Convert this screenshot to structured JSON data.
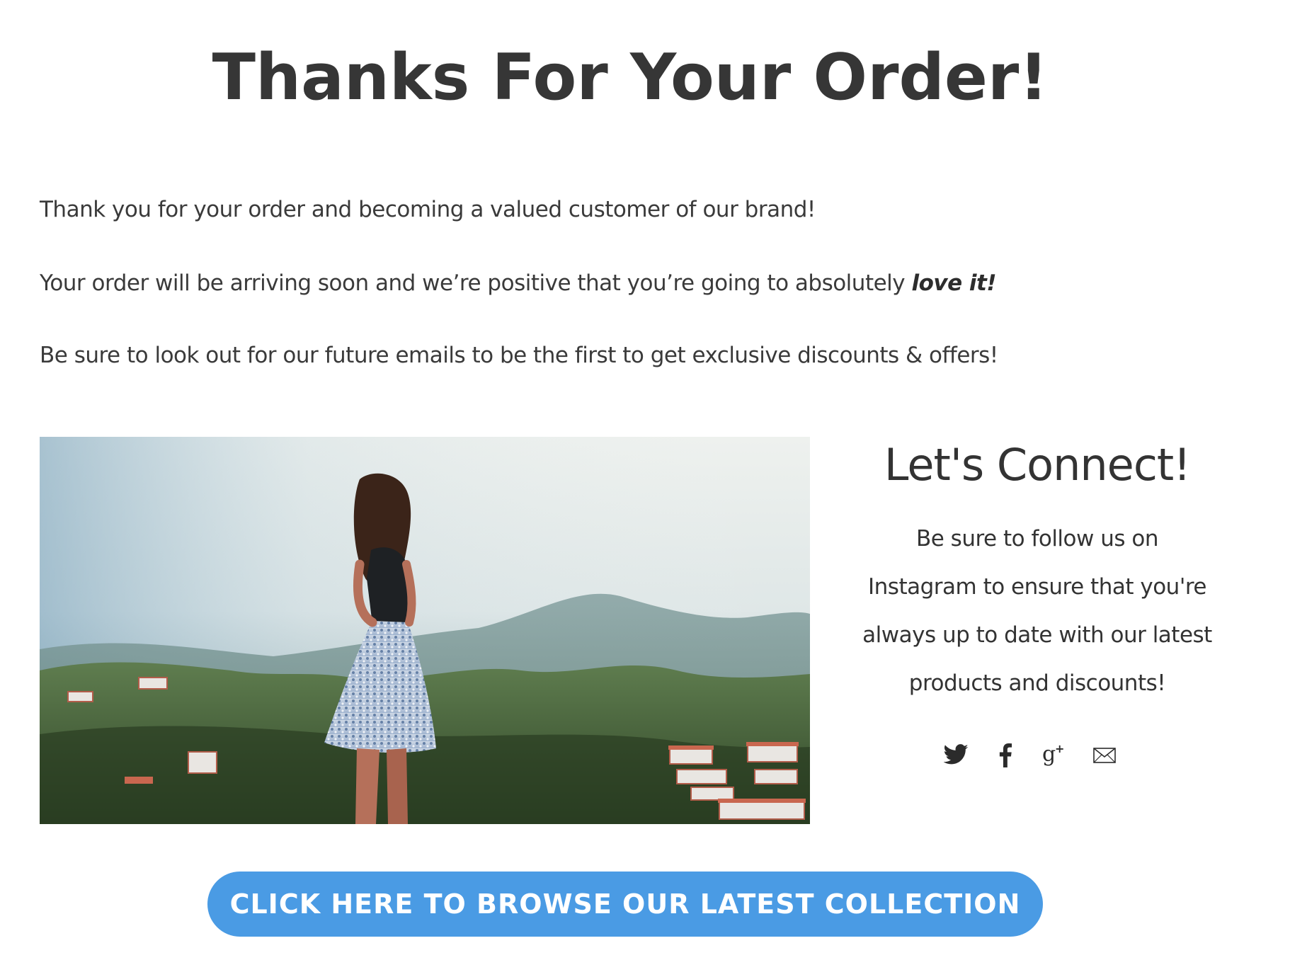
{
  "header": {
    "title": "Thanks For Your Order!"
  },
  "intro": {
    "line1": "Thank you for your order and becoming a valued customer of our brand!",
    "line2_prefix": "Your order will be arriving soon and we’re positive that you’re going to absolutely ",
    "line2_emphasis": "love it!",
    "line3": "Be sure to look out for our future emails to be the first to get exclusive discounts & offers!"
  },
  "connect": {
    "title": "Let's Connect!",
    "body_lines": [
      "Be sure to follow us on",
      "Instagram to ensure that you're",
      "always up to date with our latest",
      "products and discounts!"
    ],
    "social_icons": [
      "twitter-icon",
      "facebook-icon",
      "google-plus-icon",
      "email-icon"
    ]
  },
  "cta": {
    "label": "CLICK HERE TO BROWSE OUR LATEST COLLECTION"
  },
  "colors": {
    "heading": "#363636",
    "text": "#3a3a3a",
    "button_bg": "#4a9be4",
    "button_text": "#ffffff"
  }
}
